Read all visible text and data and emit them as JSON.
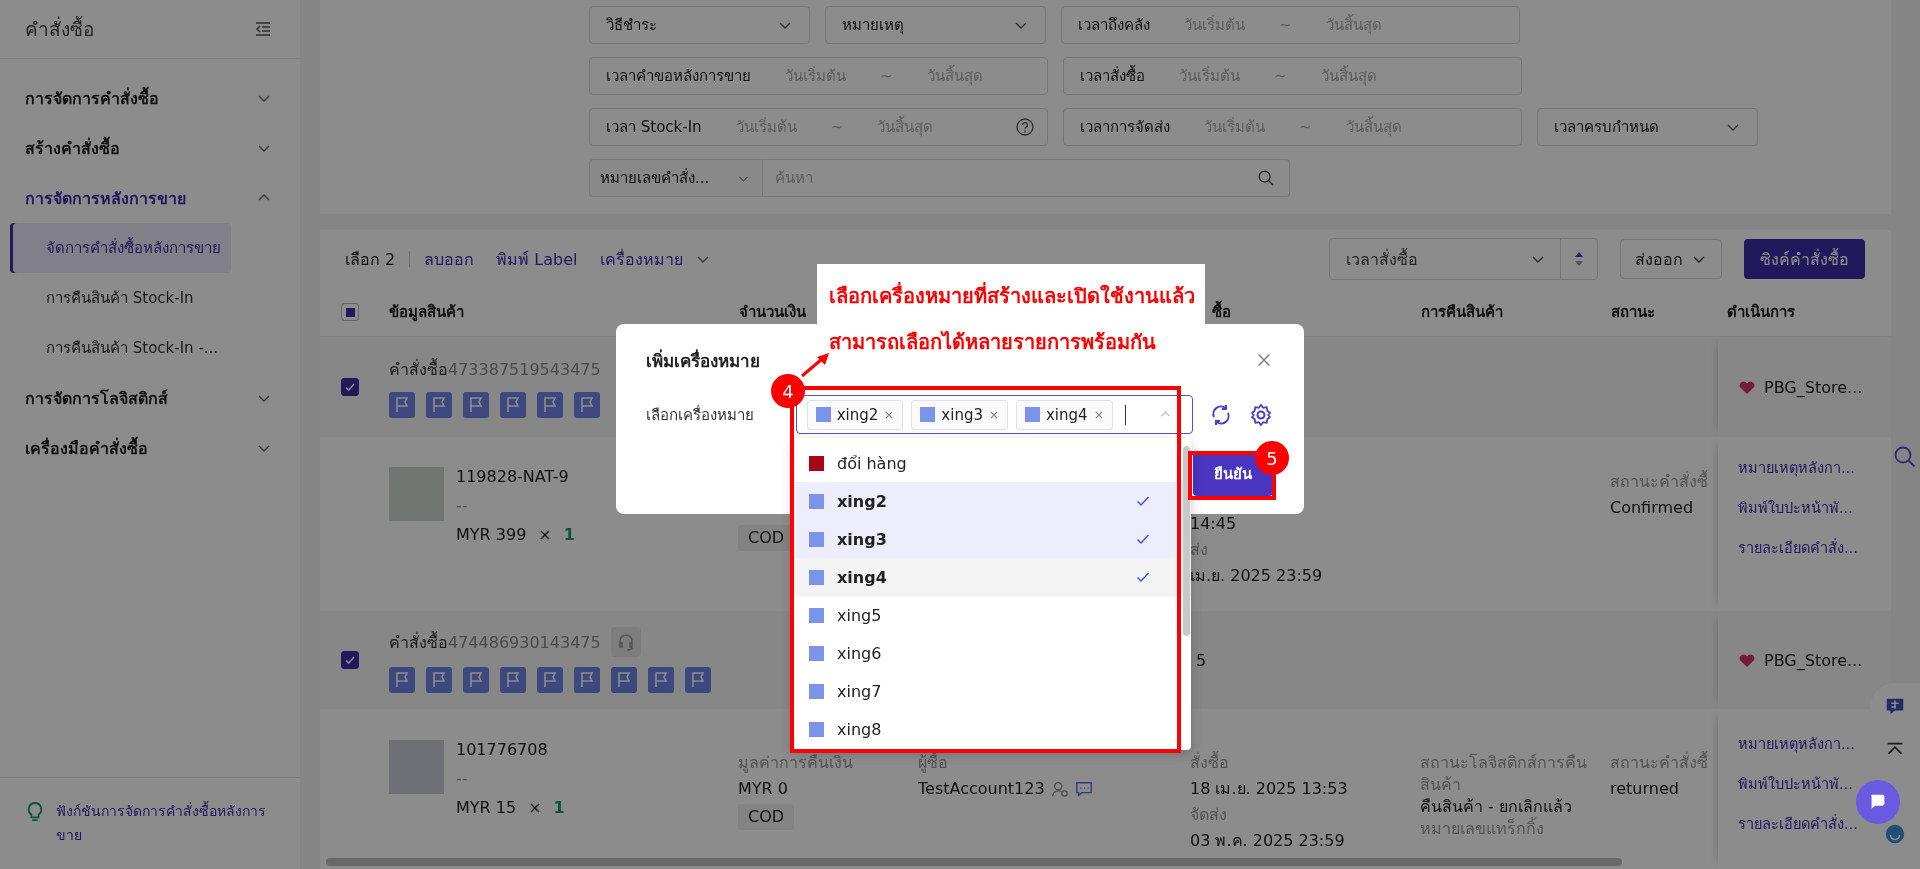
{
  "sidebar": {
    "title": "คำสั่งซื้อ",
    "menu": [
      {
        "label": "การจัดการคำสั่งซื้อ",
        "expanded": false
      },
      {
        "label": "สร้างคำสั่งซื้อ",
        "expanded": false
      },
      {
        "label": "การจัดการหลังการขาย",
        "expanded": true,
        "children": [
          {
            "label": "จัดการคำสั่งซื้อหลังการขาย",
            "selected": true
          },
          {
            "label": "การคืนสินค้า Stock-In",
            "selected": false
          },
          {
            "label": "การคืนสินค้า Stock-In -...",
            "selected": false
          }
        ]
      },
      {
        "label": "การจัดการโลจิสติกส์",
        "expanded": false
      },
      {
        "label": "เครื่องมือคำสั่งซื้อ",
        "expanded": false
      }
    ],
    "footer_link": "ฟังก์ชันการจัดการคำสั่งซื้อหลังการขาย"
  },
  "filters": [
    [
      {
        "kind": "select",
        "label": "วิธีชำระ"
      },
      {
        "kind": "select",
        "label": "หมายเหตุ"
      },
      {
        "kind": "date_range",
        "label": "เวลาถึงคลัง",
        "start": "วันเริ่มต้น",
        "separator": "~",
        "end": "วันสิ้นสุด",
        "help": false
      }
    ],
    [
      {
        "kind": "date_range",
        "label": "เวลาคำขอหลังการขาย",
        "start": "วันเริ่มต้น",
        "separator": "~",
        "end": "วันสิ้นสุด",
        "help": false
      },
      {
        "kind": "date_range",
        "label": "เวลาสั่งซื้อ",
        "start": "วันเริ่มต้น",
        "separator": "~",
        "end": "วันสิ้นสุด",
        "help": false
      }
    ],
    [
      {
        "kind": "date_range",
        "label": "เวลา Stock-In",
        "start": "วันเริ่มต้น",
        "separator": "~",
        "end": "วันสิ้นสุด",
        "help": true
      },
      {
        "kind": "date_range",
        "label": "เวลาการจัดส่ง",
        "start": "วันเริ่มต้น",
        "separator": "~",
        "end": "วันสิ้นสุด",
        "help": false
      },
      {
        "kind": "select",
        "label": "เวลาครบกำหนด"
      }
    ],
    [
      {
        "kind": "search",
        "field": "หมายเลขคำสั่ง...",
        "placeholder": "ค้นหา"
      }
    ]
  ],
  "toolbar": {
    "selection": "เลือก 2",
    "actions": [
      "ลบออก",
      "พิมพ์ Label"
    ],
    "marks_menu": "เครื่องหมาย",
    "sort_field": "เวลาสั่งซื้อ",
    "export": "ส่งออก",
    "sync": "ซิงค์คำสั่งซื้อ"
  },
  "table": {
    "select_all": {
      "partial": true
    },
    "columns": [
      "ข้อมูลสินค้า",
      "จำนวนเงิน",
      "ซื้อ",
      "การคืนสินค้า",
      "สถานะ",
      "ดำเนินการ"
    ]
  },
  "orders": [
    {
      "checked": true,
      "prefix": "คำสั่งซื้อ",
      "number": "473387519543475",
      "service_badge": false,
      "flags": [
        {
          "kind": "flag"
        },
        {
          "kind": "flag"
        },
        {
          "kind": "flag"
        },
        {
          "kind": "flag"
        },
        {
          "kind": "flag"
        },
        {
          "kind": "flag"
        }
      ],
      "store": "PBG_Store...",
      "item": {
        "sku": "119828-NAT-9",
        "variant": "--",
        "price": "MYR 399",
        "times": "×",
        "qty": "1",
        "amount": [
          {
            "kind": "tag",
            "text": "COD"
          }
        ],
        "date": [
          {
            "kind": "value",
            "text": "14:45"
          },
          {
            "kind": "label",
            "text": "ส่ง"
          },
          {
            "kind": "value",
            "text": "เม.ย. 2025 23:59"
          }
        ],
        "status_label": "สถานะคำสั่งซื้",
        "status": "Confirmed",
        "actions": [
          "หมายเหตุหลังกา...",
          "พิมพ์ใบปะหน้าพั...",
          "รายละเอียดคำสั่ง..."
        ]
      }
    },
    {
      "checked": true,
      "prefix": "คำสั่งซื้อ",
      "number": "474486930143475",
      "service_badge": true,
      "header_date": "5",
      "flags": [
        {
          "kind": "flag"
        },
        {
          "kind": "flag"
        },
        {
          "kind": "flag"
        },
        {
          "kind": "flag"
        },
        {
          "kind": "flag"
        },
        {
          "kind": "flag"
        },
        {
          "kind": "flag"
        },
        {
          "kind": "flag"
        },
        {
          "kind": "flag"
        }
      ],
      "store": "PBG_Store...",
      "item": {
        "sku": "101776708",
        "variant": "--",
        "price": "MYR 15",
        "times": "×",
        "qty": "1",
        "amount": [
          {
            "kind": "label",
            "text": "มูลค่าการคืนเงิน"
          },
          {
            "kind": "value",
            "text": "MYR 0"
          },
          {
            "kind": "tag",
            "text": "COD"
          }
        ],
        "buyer": {
          "label": "ผู้ซื้อ",
          "name": "TestAccount123"
        },
        "date": [
          {
            "kind": "label",
            "text": "สั่งซื้อ"
          },
          {
            "kind": "value",
            "text": "18 เม.ย. 2025 13:53"
          },
          {
            "kind": "label",
            "text": "จัดส่ง"
          },
          {
            "kind": "value",
            "text": "03 พ.ค. 2025 23:59"
          }
        ],
        "return": [
          {
            "kind": "label",
            "text": "สถานะโลจิสติกส์การคืนสินค้า"
          },
          {
            "kind": "value",
            "text": "คืนสินค้า - ยกเลิกแล้ว"
          },
          {
            "kind": "label",
            "text": "หมายเลขแทร็กกิ้ง"
          }
        ],
        "status_label": "สถานะคำสั่งซื้",
        "status": "returned",
        "actions": [
          "หมายเหตุหลังกา...",
          "พิมพ์ใบปะหน้าพั...",
          "รายละเอียดคำสั่ง..."
        ]
      }
    }
  ],
  "modal": {
    "title": "เพิ่มเครื่องหมาย",
    "field_label": "เลือกเครื่องหมาย",
    "selected_tags": [
      {
        "label": "xing2",
        "color": "#7b93e8"
      },
      {
        "label": "xing3",
        "color": "#7b93e8"
      },
      {
        "label": "xing4",
        "color": "#7b93e8"
      }
    ],
    "options": [
      {
        "label": "đổi hàng",
        "color": "#a8071a",
        "selected": false,
        "hovered": false
      },
      {
        "label": "xing2",
        "color": "#7b93e8",
        "selected": true,
        "hovered": false
      },
      {
        "label": "xing3",
        "color": "#7b93e8",
        "selected": true,
        "hovered": false
      },
      {
        "label": "xing4",
        "color": "#7b93e8",
        "selected": true,
        "hovered": true
      },
      {
        "label": "xing5",
        "color": "#7b93e8",
        "selected": false,
        "hovered": false
      },
      {
        "label": "xing6",
        "color": "#7b93e8",
        "selected": false,
        "hovered": false
      },
      {
        "label": "xing7",
        "color": "#7b93e8",
        "selected": false,
        "hovered": false
      },
      {
        "label": "xing8",
        "color": "#7b93e8",
        "selected": false,
        "hovered": false
      }
    ],
    "confirm_button": "ยืนยัน"
  },
  "callout": {
    "lines": [
      "เลือกเครื่องหมายที่สร้างและเปิดใช้งานแล้ว",
      "สามารถเลือกได้หลายรายการพร้อมกัน"
    ]
  },
  "annotations": [
    {
      "number": "4"
    },
    {
      "number": "5"
    }
  ]
}
